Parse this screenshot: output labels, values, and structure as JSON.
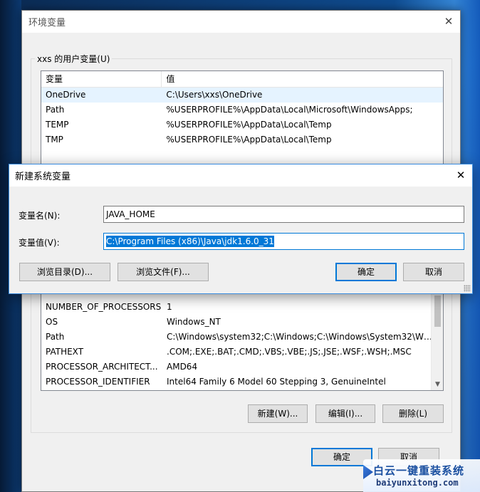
{
  "env_window": {
    "title": "环境变量",
    "user_group_label": "xxs 的用户变量(U)",
    "user_columns": [
      "变量",
      "值"
    ],
    "user_rows": [
      {
        "name": "OneDrive",
        "value": "C:\\Users\\xxs\\OneDrive"
      },
      {
        "name": "Path",
        "value": "%USERPROFILE%\\AppData\\Local\\Microsoft\\WindowsApps;"
      },
      {
        "name": "TEMP",
        "value": "%USERPROFILE%\\AppData\\Local\\Temp"
      },
      {
        "name": "TMP",
        "value": "%USERPROFILE%\\AppData\\Local\\Temp"
      }
    ],
    "system_rows": [
      {
        "name": "NUMBER_OF_PROCESSORS",
        "value": "1"
      },
      {
        "name": "OS",
        "value": "Windows_NT"
      },
      {
        "name": "Path",
        "value": "C:\\Windows\\system32;C:\\Windows;C:\\Windows\\System32\\Wb..."
      },
      {
        "name": "PATHEXT",
        "value": ".COM;.EXE;.BAT;.CMD;.VBS;.VBE;.JS;.JSE;.WSF;.WSH;.MSC"
      },
      {
        "name": "PROCESSOR_ARCHITECT...",
        "value": "AMD64"
      },
      {
        "name": "PROCESSOR_IDENTIFIER",
        "value": "Intel64 Family 6 Model 60 Stepping 3, GenuineIntel"
      }
    ],
    "new_button": "新建(W)...",
    "edit_button": "编辑(I)...",
    "delete_button": "删除(L)",
    "ok_button": "确定",
    "cancel_button": "取消"
  },
  "dialog": {
    "title": "新建系统变量",
    "name_label": "变量名(N):",
    "name_value": "JAVA_HOME",
    "value_label": "变量值(V):",
    "value_value": "C:\\Program Files (x86)\\Java\\jdk1.6.0_31",
    "browse_dir_button": "浏览目录(D)...",
    "browse_file_button": "浏览文件(F)...",
    "ok_button": "确定",
    "cancel_button": "取消"
  },
  "watermark": {
    "title": "白云一键重装系统",
    "url": "baiyunxitong.com"
  },
  "colors": {
    "accent": "#0078d7",
    "selection_bg": "#e5f3ff"
  }
}
